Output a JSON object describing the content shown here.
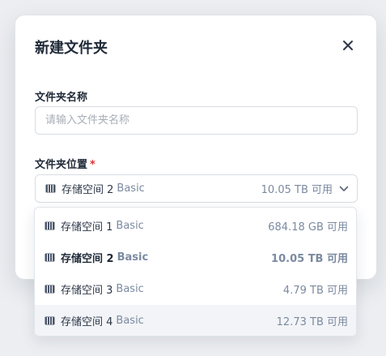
{
  "dialog": {
    "title": "新建文件夹",
    "name_label": "文件夹名称",
    "name_placeholder": "请输入文件夹名称",
    "location_label": "文件夹位置",
    "required_mark": "*"
  },
  "location_select": {
    "selected_name": "存储空间 2",
    "selected_tag": "Basic",
    "selected_free": "10.05 TB 可用"
  },
  "options": [
    {
      "name": "存储空间 1",
      "tag": "Basic",
      "free": "684.18 GB 可用"
    },
    {
      "name": "存储空间 2",
      "tag": "Basic",
      "free": "10.05 TB 可用"
    },
    {
      "name": "存储空间 3",
      "tag": "Basic",
      "free": "4.79 TB 可用"
    },
    {
      "name": "存储空间 4",
      "tag": "Basic",
      "free": "12.73 TB 可用"
    }
  ],
  "colors": {
    "accent_required": "#e03131",
    "muted": "#7b8aa0"
  },
  "icons": {
    "close": "close-icon",
    "storage": "storage-icon",
    "chevron": "chevron-down-icon"
  }
}
